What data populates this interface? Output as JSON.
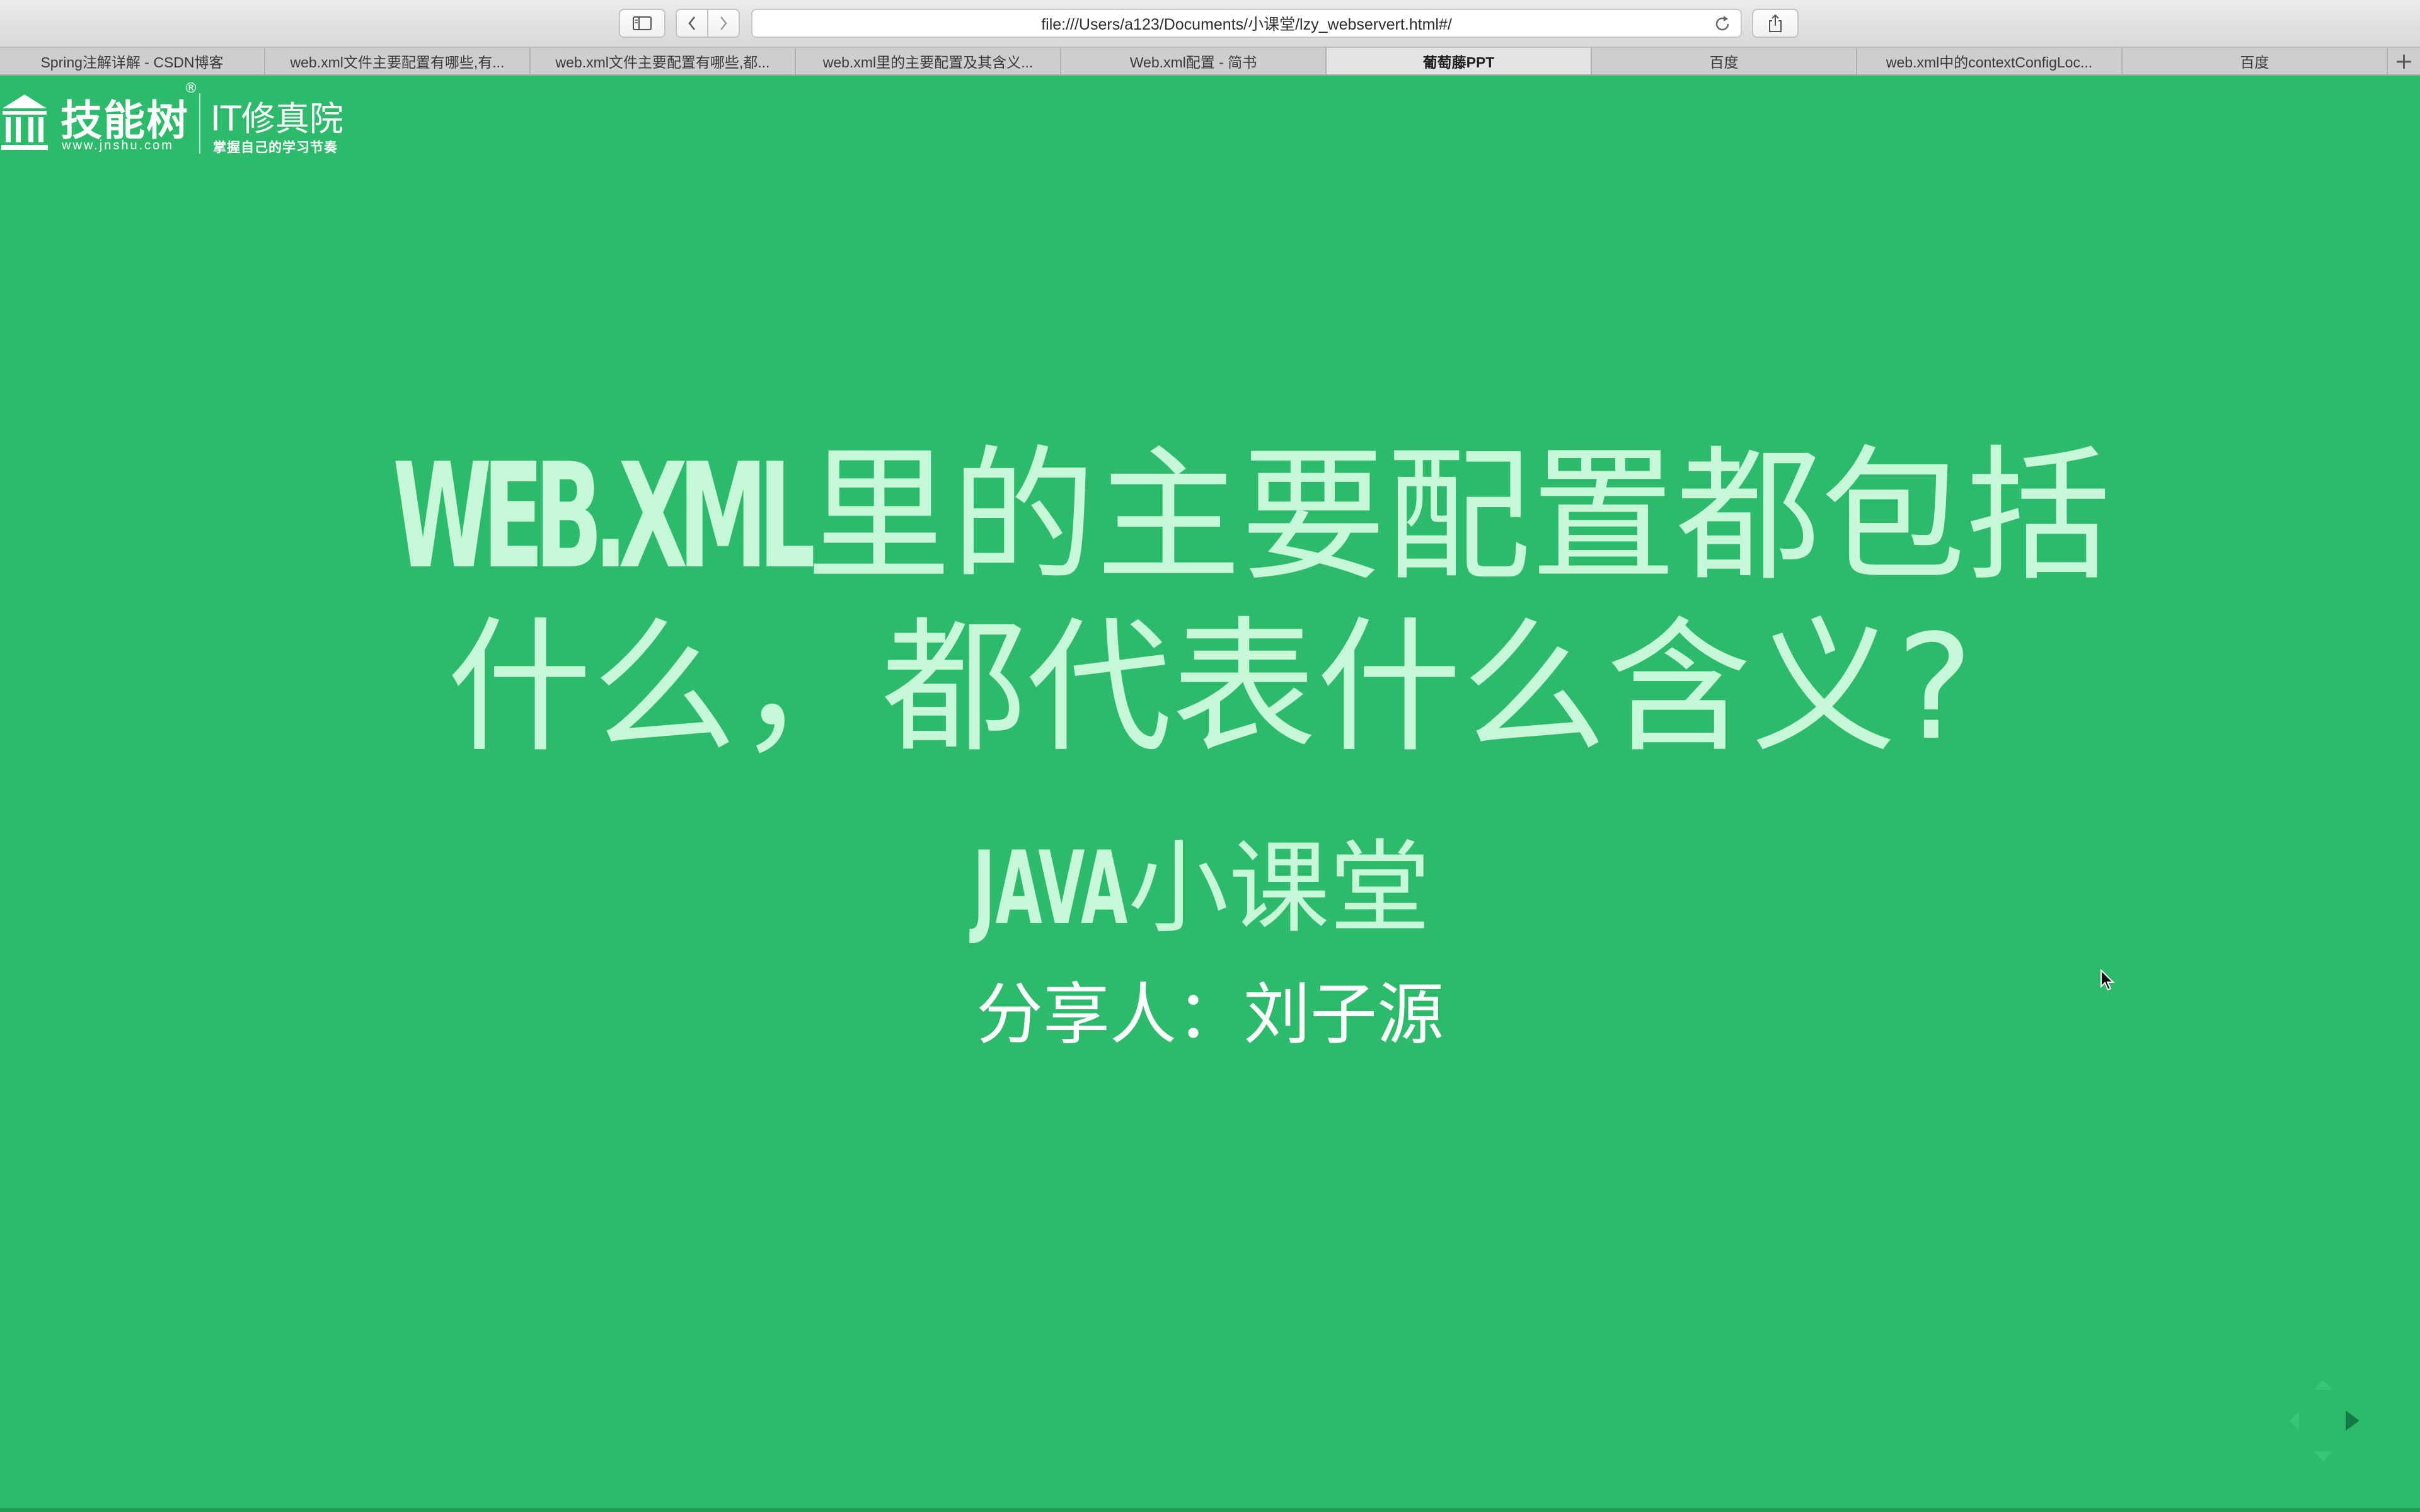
{
  "browser": {
    "url": "file:///Users/a123/Documents/小课堂/lzy_webservert.html#/",
    "tabs": [
      {
        "label": "Spring注解详解 - CSDN博客",
        "active": false
      },
      {
        "label": "web.xml文件主要配置有哪些,有...",
        "active": false
      },
      {
        "label": "web.xml文件主要配置有哪些,都...",
        "active": false
      },
      {
        "label": "web.xml里的主要配置及其含义...",
        "active": false
      },
      {
        "label": "Web.xml配置 - 简书",
        "active": false
      },
      {
        "label": "葡萄藤PPT",
        "active": true
      },
      {
        "label": "百度",
        "active": false
      },
      {
        "label": "web.xml中的contextConfigLoc...",
        "active": false
      },
      {
        "label": "百度",
        "active": false
      }
    ],
    "new_tab_label": "+"
  },
  "logo": {
    "brand_cn": "技能树",
    "brand_url": "www.jnshu.com",
    "registered": "®",
    "academy": "IT修真院",
    "slogan": "掌握自己的学习节奏"
  },
  "slide": {
    "title_latin": "WEB.XML",
    "title_cn": "里的主要配置都包括什么，都代表什么含义?",
    "subtitle_latin": "JAVA",
    "subtitle_cn": "小课堂",
    "presenter": "分享人：刘子源"
  },
  "colors": {
    "slide_background": "#2dbb6b",
    "title_text": "#c6f7d7",
    "presenter_text": "#ffffff"
  },
  "icons": {
    "sidebar": "sidebar-icon",
    "back": "chevron-left-icon",
    "forward": "chevron-right-icon",
    "reload": "reload-icon",
    "share": "share-icon",
    "logo": "temple-icon",
    "pointer": "mouse-pointer-icon",
    "nav": "slide-nav-arrows-icon"
  }
}
